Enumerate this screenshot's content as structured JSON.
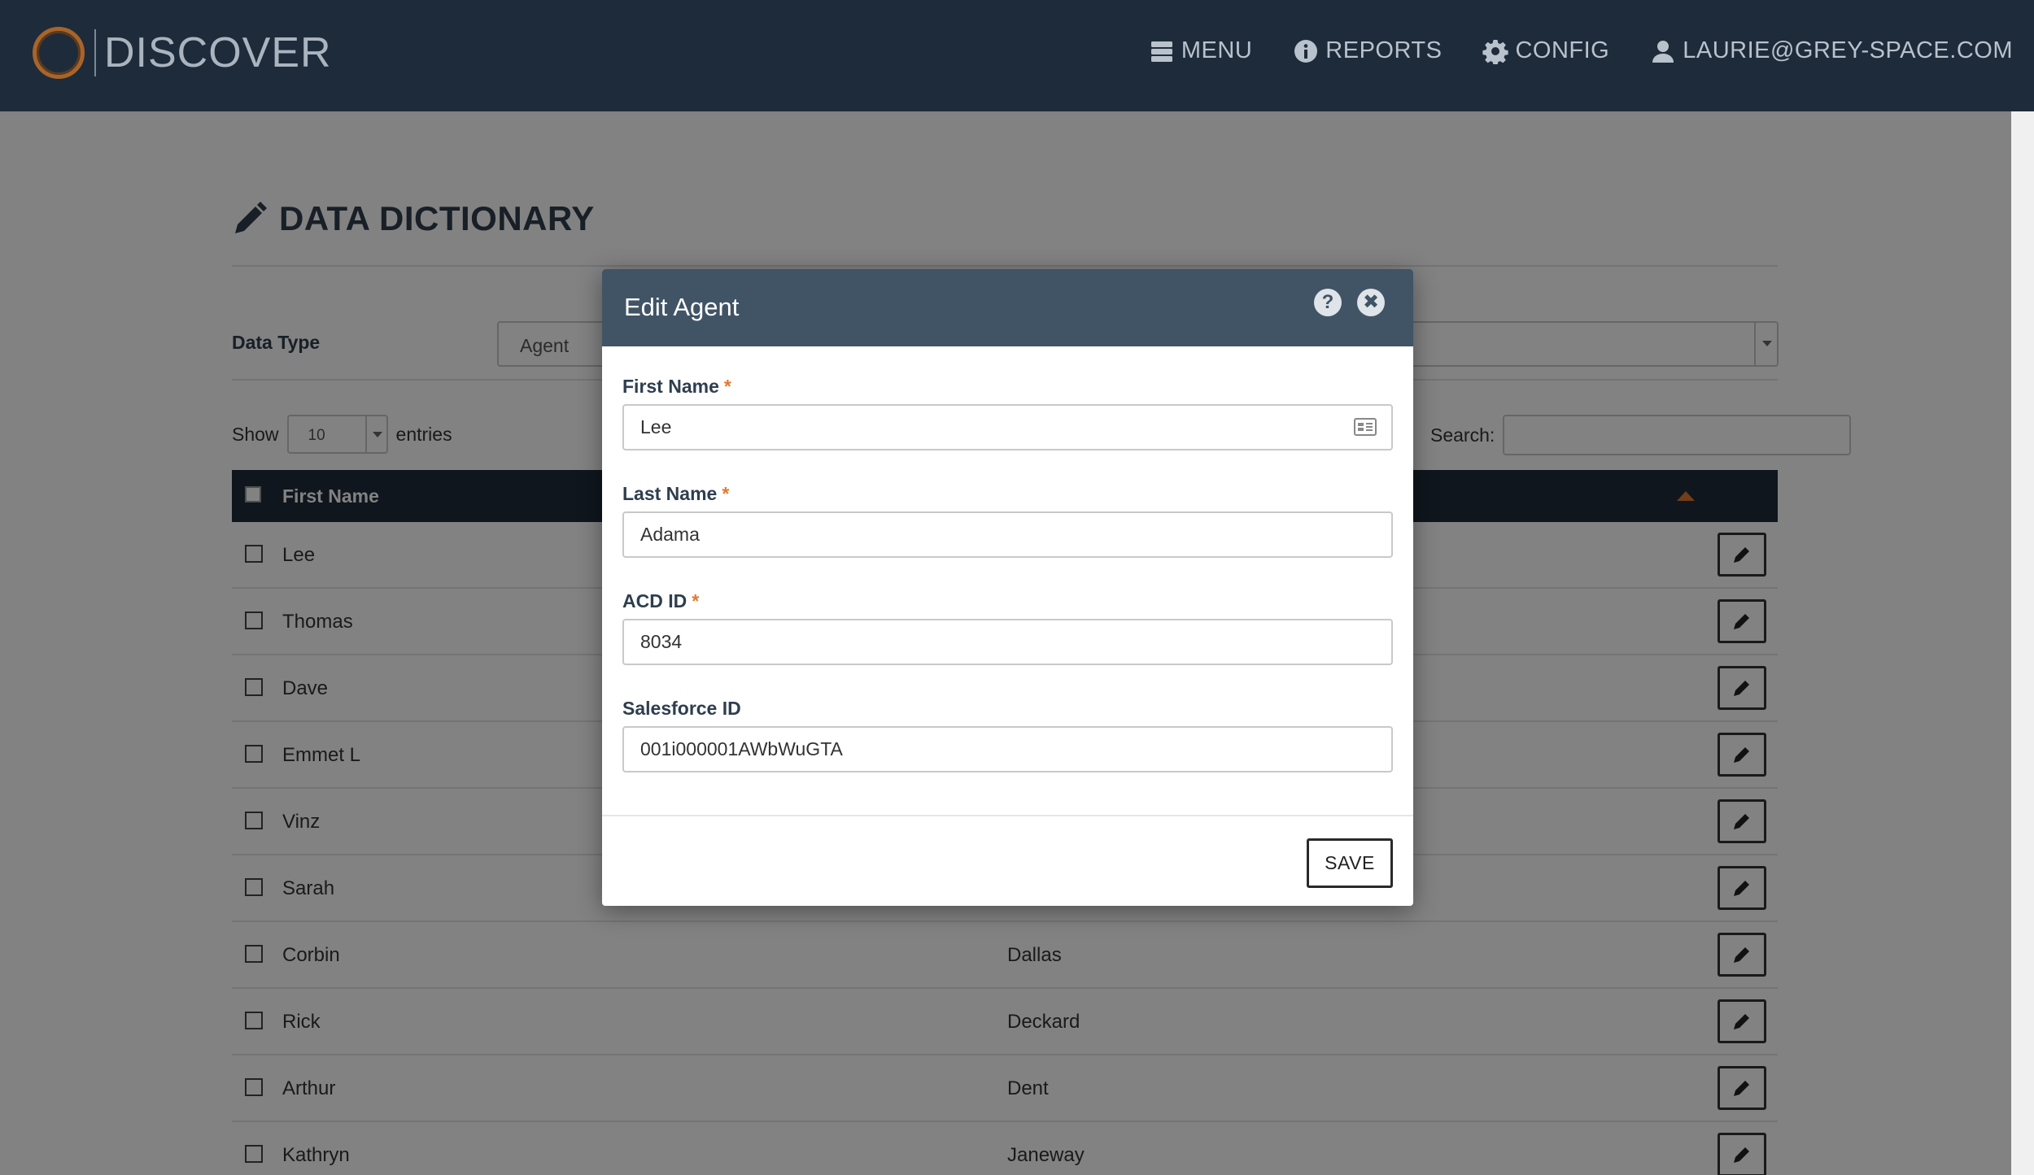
{
  "app": {
    "logo_text": "DISCOVER"
  },
  "nav": {
    "menu": "MENU",
    "reports": "REPORTS",
    "config": "CONFIG",
    "user": "LAURIE@GREY-SPACE.COM"
  },
  "page": {
    "title": "DATA DICTIONARY",
    "data_type_label": "Data Type",
    "data_type_value": "Agent",
    "show_label": "Show",
    "entries_value": "10",
    "entries_label": "entries",
    "search_label": "Search:",
    "search_value": ""
  },
  "table": {
    "columns": [
      "First Name"
    ],
    "rows": [
      {
        "first": "Lee",
        "last": ""
      },
      {
        "first": "Thomas",
        "last": ""
      },
      {
        "first": "Dave",
        "last": ""
      },
      {
        "first": "Emmet L",
        "last": ""
      },
      {
        "first": "Vinz",
        "last": ""
      },
      {
        "first": "Sarah",
        "last": ""
      },
      {
        "first": "Corbin",
        "last": "Dallas"
      },
      {
        "first": "Rick",
        "last": "Deckard"
      },
      {
        "first": "Arthur",
        "last": "Dent"
      },
      {
        "first": "Kathryn",
        "last": "Janeway"
      }
    ]
  },
  "modal": {
    "title": "Edit Agent",
    "help_symbol": "?",
    "close_symbol": "✖",
    "fields": [
      {
        "label": "First Name",
        "required_mark": "*",
        "value": "Lee"
      },
      {
        "label": "Last Name",
        "required_mark": "*",
        "value": "Adama"
      },
      {
        "label": "ACD ID",
        "required_mark": "*",
        "value": "8034"
      },
      {
        "label": "Salesforce ID",
        "required_mark": "",
        "value": "001i000001AWbWuGTA"
      }
    ],
    "save_label": "SAVE"
  },
  "colors": {
    "header_bg": "#1e2b3a",
    "modal_header_bg": "#415466",
    "accent": "#e07a2e",
    "logo_ring": "#a8642a"
  }
}
